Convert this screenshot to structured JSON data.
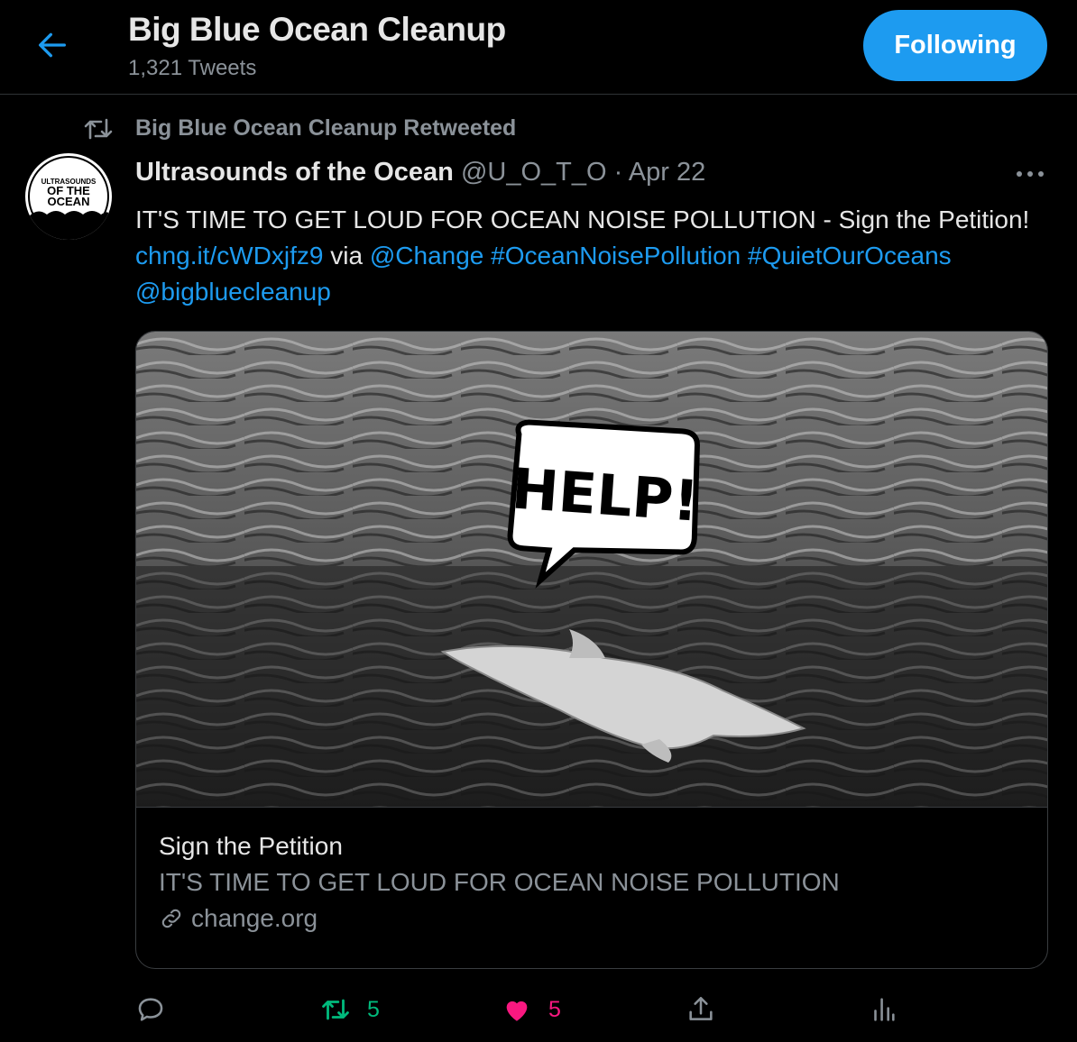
{
  "header": {
    "title": "Big Blue Ocean Cleanup",
    "tweet_count": "1,321 Tweets",
    "follow_label": "Following"
  },
  "retweet_context": "Big Blue Ocean Cleanup Retweeted",
  "avatar": {
    "line1": "ULTRASOUNDS",
    "line2": "OF THE",
    "line3": "OCEAN"
  },
  "tweet": {
    "author_name": "Ultrasounds of the Ocean",
    "author_handle": "@U_O_T_O",
    "separator": "·",
    "date": "Apr 22",
    "text_part1": "IT'S TIME TO GET LOUD FOR OCEAN NOISE POLLUTION - Sign the Petition!",
    "link_url": "chng.it/cWDxjfz9",
    "text_via": "via",
    "mention_change": "@Change",
    "hashtag1": "#OceanNoisePollution",
    "hashtag2": "#QuietOurOceans",
    "mention_bbc": "@bigbluecleanup"
  },
  "card": {
    "image_text": "HELP!",
    "title": "Sign the Petition",
    "description": "IT'S TIME TO GET LOUD FOR OCEAN NOISE POLLUTION",
    "domain": "change.org"
  },
  "actions": {
    "retweets": "5",
    "likes": "5"
  },
  "colors": {
    "accent": "#1d9bf0",
    "retweet_green": "#00ba7c",
    "like_pink": "#f91880",
    "muted": "#8b9299"
  }
}
